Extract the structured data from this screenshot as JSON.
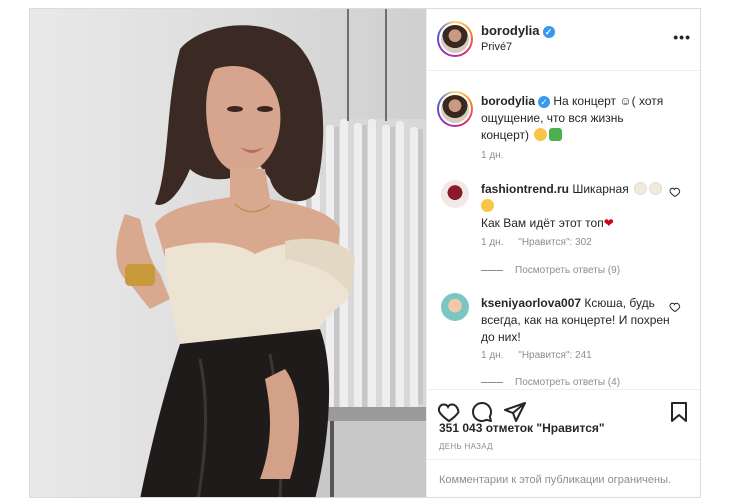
{
  "post": {
    "username": "borodylia",
    "location": "Privé7",
    "caption": "На концерт ☺( хотя ощущение, что вся жизнь концерт)",
    "caption_time": "1 дн."
  },
  "comments": [
    {
      "username": "fashiontrend.ru",
      "text_line1": "Шикарная",
      "text_line2": "Как Вам идёт этот топ",
      "time": "1 дн.",
      "likes": "\"Нравится\": 302",
      "replies": "Посмотреть ответы (9)"
    },
    {
      "username": "kseniyaorlova007",
      "text": "Ксюша, будь всегда, как на концерте! И похрен до них!",
      "time": "1 дн.",
      "likes": "\"Нравится\": 241",
      "replies": "Посмотреть ответы (4)"
    }
  ],
  "stats": {
    "likes": "351 043 отметок \"Нравится\"",
    "date": "ДЕНЬ НАЗАД"
  },
  "footer": {
    "limited_text": "Комментарии к этой публикации ограничены."
  },
  "icons": [
    "heart-icon",
    "comment-icon",
    "share-icon",
    "bookmark-icon",
    "more-options-icon",
    "verified-badge-icon"
  ],
  "colors": {
    "verified": "#3897f0",
    "meta_text": "#8e8e8e",
    "border": "#dbdbdb"
  }
}
